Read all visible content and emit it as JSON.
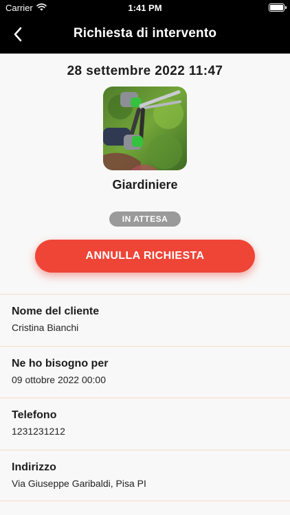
{
  "status_bar": {
    "carrier": "Carrier",
    "time": "1:41 PM"
  },
  "header": {
    "title": "Richiesta di intervento",
    "back_icon": "chevron-left-icon"
  },
  "request": {
    "date": "28 settembre 2022 11:47",
    "category": "Giardiniere",
    "status": "IN ATTESA",
    "cancel_label": "ANNULLA RICHIESTA"
  },
  "details": [
    {
      "label": "Nome del cliente",
      "value": "Cristina Bianchi"
    },
    {
      "label": "Ne ho bisogno per",
      "value": "09 ottobre 2022 00:00"
    },
    {
      "label": "Telefono",
      "value": "1231231212"
    },
    {
      "label": "Indirizzo",
      "value": "Via Giuseppe Garibaldi, Pisa PI"
    }
  ],
  "colors": {
    "header_background": "#000000",
    "accent_red": "#ee4537",
    "status_badge": "#9a9a9a",
    "divider": "#f6dcc5"
  }
}
